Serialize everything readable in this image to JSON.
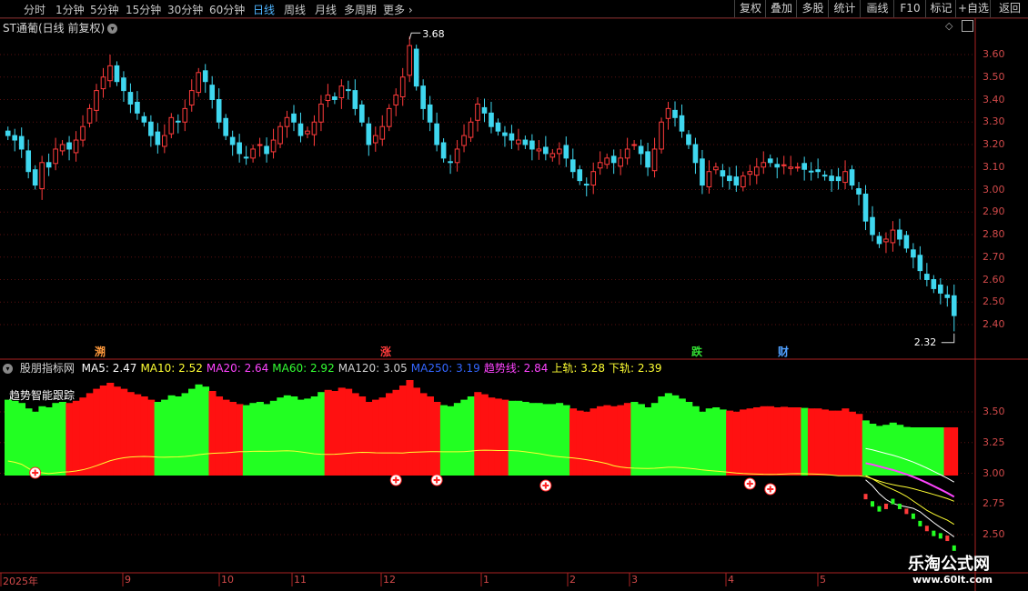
{
  "toolbar": {
    "periods": [
      "分时",
      "1分钟",
      "5分钟",
      "15分钟",
      "30分钟",
      "60分钟",
      "日线",
      "周线",
      "月线",
      "多周期",
      "更多"
    ],
    "active_period": "日线",
    "more_arrow": "›",
    "right_buttons": [
      "复权",
      "叠加",
      "多股",
      "统计",
      "画线",
      "F10",
      "标记",
      "+自选",
      "返回"
    ]
  },
  "stock": {
    "title": "ST通葡(日线 前复权)",
    "high_label": "3.68",
    "low_label": "2.32"
  },
  "price_axis": [
    "3.60",
    "3.50",
    "3.40",
    "3.30",
    "3.20",
    "3.10",
    "3.00",
    "2.90",
    "2.80",
    "2.70",
    "2.60",
    "2.50",
    "2.40"
  ],
  "indicator_axis": [
    "3.50",
    "3.25",
    "3.00",
    "2.75",
    "2.50"
  ],
  "events": [
    {
      "text": "溯",
      "color": "#ff9a3c"
    },
    {
      "text": "涨",
      "color": "#ff3b3b"
    },
    {
      "text": "跌",
      "color": "#33dd33"
    },
    {
      "text": "财",
      "color": "#4fa0ff"
    }
  ],
  "indicator": {
    "name": "股朋指标网",
    "title": "趋势智能跟踪",
    "legend": [
      {
        "label": "MA5: 2.47",
        "color": "#ffffff"
      },
      {
        "label": "MA10: 2.52",
        "color": "#ffff33"
      },
      {
        "label": "MA20: 2.64",
        "color": "#ff44ff"
      },
      {
        "label": "MA60: 2.92",
        "color": "#33ff33"
      },
      {
        "label": "MA120: 3.05",
        "color": "#d0d0d0"
      },
      {
        "label": "MA250: 3.19",
        "color": "#3366ff"
      },
      {
        "label": "趋势线: 2.84",
        "color": "#ff44ff"
      },
      {
        "label": "上轨: 3.28",
        "color": "#ffff33"
      },
      {
        "label": "下轨: 2.39",
        "color": "#ffff33"
      }
    ]
  },
  "date_axis": [
    "2025年",
    "9",
    "10",
    "11",
    "12",
    "1",
    "2",
    "3",
    "4",
    "5"
  ],
  "watermark": {
    "name": "乐淘公式网",
    "url": "www.60lt.com"
  },
  "colors": {
    "up": "#ff3b3b",
    "down": "#3fd7ef",
    "bull": "#22ff22",
    "bear": "#ff1111",
    "grid": "#5a1010"
  },
  "chart_data": {
    "type": "candlestick",
    "closes": [
      3.24,
      3.22,
      3.18,
      3.08,
      3.02,
      3.12,
      3.1,
      3.18,
      3.2,
      3.18,
      3.22,
      3.28,
      3.36,
      3.44,
      3.5,
      3.55,
      3.48,
      3.44,
      3.38,
      3.34,
      3.3,
      3.24,
      3.2,
      3.24,
      3.32,
      3.3,
      3.36,
      3.44,
      3.52,
      3.48,
      3.4,
      3.3,
      3.24,
      3.2,
      3.16,
      3.14,
      3.18,
      3.2,
      3.16,
      3.22,
      3.28,
      3.32,
      3.3,
      3.24,
      3.26,
      3.3,
      3.38,
      3.42,
      3.4,
      3.46,
      3.44,
      3.36,
      3.3,
      3.2,
      3.24,
      3.28,
      3.36,
      3.42,
      3.5,
      3.64,
      3.46,
      3.36,
      3.3,
      3.2,
      3.14,
      3.12,
      3.18,
      3.24,
      3.3,
      3.38,
      3.34,
      3.28,
      3.26,
      3.24,
      3.22,
      3.22,
      3.2,
      3.18,
      3.18,
      3.16,
      3.16,
      3.18,
      3.14,
      3.08,
      3.04,
      3.02,
      3.08,
      3.12,
      3.14,
      3.12,
      3.14,
      3.18,
      3.2,
      3.16,
      3.1,
      3.18,
      3.3,
      3.36,
      3.32,
      3.26,
      3.2,
      3.12,
      3.02,
      3.08,
      3.1,
      3.06,
      3.04,
      3.02,
      3.06,
      3.08,
      3.1,
      3.12,
      3.12,
      3.1,
      3.11,
      3.1,
      3.1,
      3.09,
      3.08,
      3.08,
      3.06,
      3.04,
      3.04,
      3.08,
      3.02,
      2.98,
      2.86,
      2.8,
      2.76,
      2.78,
      2.82,
      2.78,
      2.74,
      2.7,
      2.64,
      2.6,
      2.56,
      2.54,
      2.52,
      2.44
    ],
    "ylim": [
      2.32,
      3.68
    ],
    "high": 3.68,
    "low": 2.32,
    "regimes": [
      {
        "trend": "bull",
        "n": 9
      },
      {
        "trend": "bear",
        "n": 13
      },
      {
        "trend": "bull",
        "n": 8
      },
      {
        "trend": "bear",
        "n": 5
      },
      {
        "trend": "bull",
        "n": 12
      },
      {
        "trend": "bear",
        "n": 17
      },
      {
        "trend": "bull",
        "n": 5
      },
      {
        "trend": "bear",
        "n": 5
      },
      {
        "trend": "bull",
        "n": 9
      },
      {
        "trend": "bear",
        "n": 9
      },
      {
        "trend": "bull",
        "n": 14
      },
      {
        "trend": "bear",
        "n": 11
      },
      {
        "trend": "bull",
        "n": 1
      },
      {
        "trend": "bear",
        "n": 8
      },
      {
        "trend": "bull",
        "n": 12
      },
      {
        "trend": "bear",
        "n": 12
      },
      {
        "trend": "bull",
        "n": 5
      },
      {
        "trend": "bear",
        "n": 1
      },
      {
        "trend": "bull",
        "n": 1
      },
      {
        "trend": "bear",
        "n": 1
      },
      {
        "trend": "bull",
        "n": 18
      }
    ]
  }
}
